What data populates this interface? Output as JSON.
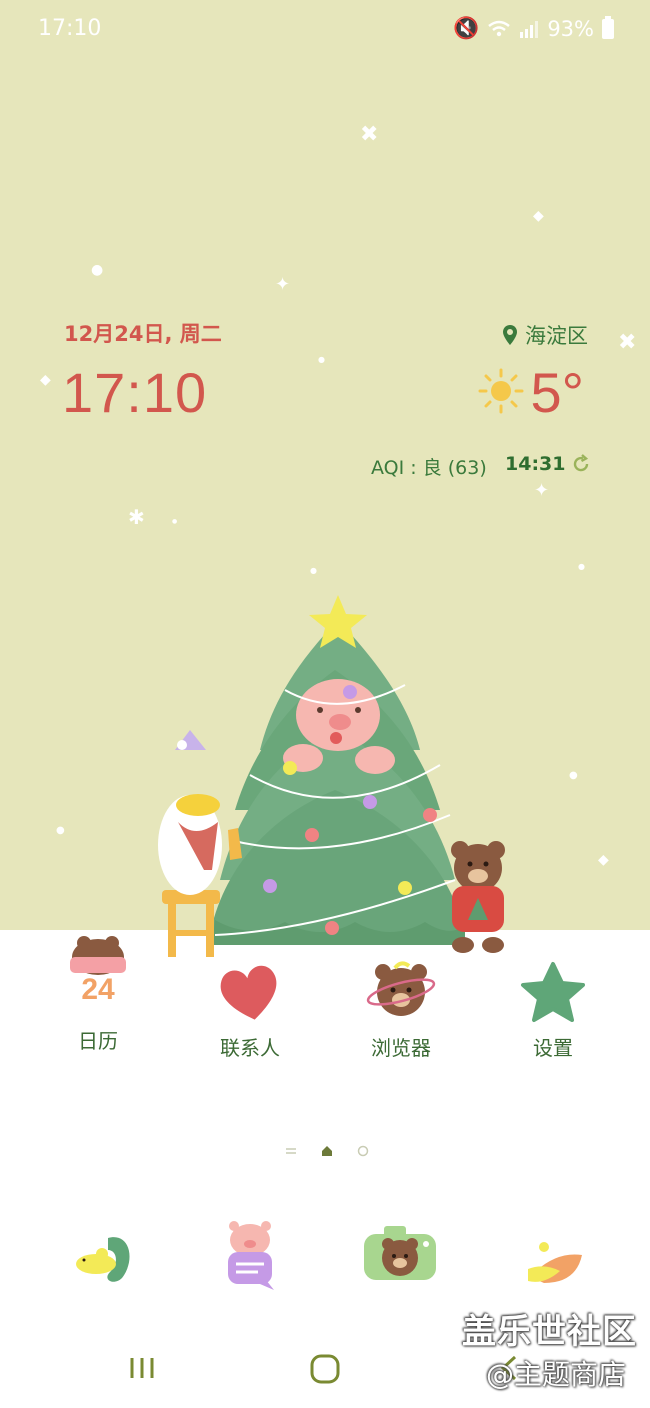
{
  "status_bar": {
    "time": "17:10",
    "battery": "93%"
  },
  "widget": {
    "date": "12月24日, 周二",
    "time": "17:10",
    "location": "海淀区",
    "temperature": "5°",
    "aqi": "AQI : 良 (63)",
    "updated_time": "14:31",
    "icons": [
      "location-pin-icon",
      "sun-icon",
      "refresh-icon"
    ]
  },
  "apps": [
    {
      "label": "日历",
      "badge": "24",
      "icon": "calendar-bear-icon"
    },
    {
      "label": "联系人",
      "icon": "heart-mitten-icon"
    },
    {
      "label": "浏览器",
      "icon": "bear-planet-icon"
    },
    {
      "label": "设置",
      "icon": "star-icon"
    }
  ],
  "page_indicator": {
    "pages": 3,
    "current": 2
  },
  "dock": [
    {
      "icon": "phone-duck-icon"
    },
    {
      "icon": "message-pig-icon"
    },
    {
      "icon": "camera-bear-icon"
    },
    {
      "icon": "gallery-leaf-icon"
    }
  ],
  "navbar": {
    "icons": [
      "recents-icon",
      "home-icon",
      "back-icon"
    ]
  },
  "watermark": {
    "line1": "盖乐世社区",
    "line2": "@主题商店"
  },
  "colors": {
    "wallpaper": "#e6e6bb",
    "accent_red": "#d2574d",
    "accent_green": "#3b7a3c"
  }
}
